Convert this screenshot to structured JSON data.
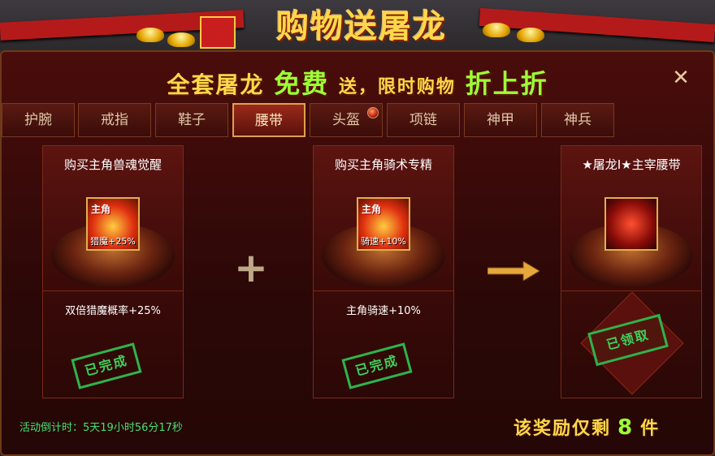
{
  "banner": {
    "title": "购物送屠龙"
  },
  "header": {
    "part1": "全套屠龙",
    "free": "免费",
    "part2": "送，限时购物",
    "part3": "折上折"
  },
  "tabs": [
    {
      "label": "护腕"
    },
    {
      "label": "戒指"
    },
    {
      "label": "鞋子"
    },
    {
      "label": "腰带",
      "active": true
    },
    {
      "label": "头盔",
      "badge": true
    },
    {
      "label": "项链"
    },
    {
      "label": "神甲"
    },
    {
      "label": "神兵"
    }
  ],
  "cards": [
    {
      "title": "购买主角兽魂觉醒",
      "icon_tag": "主角",
      "icon_label": "猎魔+25%",
      "desc": "双倍猎魔概率+25%",
      "status": "已完成",
      "icon": "beast-soul-icon"
    },
    {
      "title": "购买主角骑术专精",
      "icon_tag": "主角",
      "icon_label": "骑速+10%",
      "desc": "主角骑速+10%",
      "status": "已完成",
      "icon": "riding-icon"
    },
    {
      "title": "★屠龙Ⅰ★主宰腰带",
      "desc": "",
      "status": "已领取",
      "icon": "dragon-belt-icon"
    }
  ],
  "footer": {
    "countdown": "活动倒计时：5天19小时56分17秒"
  },
  "remaining": {
    "prefix": "该奖励仅剩",
    "count": "8",
    "suffix": "件"
  },
  "colors": {
    "gold": "#ffd84a",
    "green": "#9cff3a",
    "stamp": "#2fb34a"
  }
}
